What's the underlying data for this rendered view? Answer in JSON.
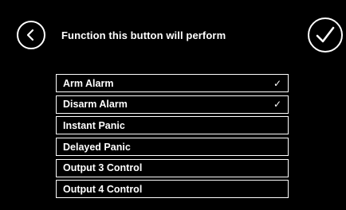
{
  "header": {
    "title": "Function this button will perform",
    "back_icon": "chevron-left-icon",
    "confirm_icon": "checkmark-icon"
  },
  "options": [
    {
      "label": "Arm Alarm",
      "checked": true,
      "check_glyph": "✓"
    },
    {
      "label": "Disarm Alarm",
      "checked": true,
      "check_glyph": "✓"
    },
    {
      "label": "Instant Panic",
      "checked": false,
      "check_glyph": ""
    },
    {
      "label": "Delayed Panic",
      "checked": false,
      "check_glyph": ""
    },
    {
      "label": "Output 3 Control",
      "checked": false,
      "check_glyph": ""
    },
    {
      "label": "Output 4 Control",
      "checked": false,
      "check_glyph": ""
    }
  ],
  "colors": {
    "background": "#000000",
    "foreground": "#ffffff"
  }
}
